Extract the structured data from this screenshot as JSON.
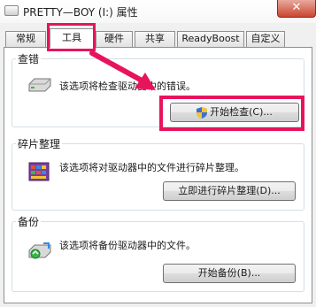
{
  "window": {
    "title": "PRETTY—BOY (I:) 属性",
    "close_glyph": "✕"
  },
  "tabs": [
    {
      "label": "常规"
    },
    {
      "label": "工具",
      "active": true
    },
    {
      "label": "硬件"
    },
    {
      "label": "共享"
    },
    {
      "label": "ReadyBoost"
    },
    {
      "label": "自定义"
    }
  ],
  "error_check": {
    "title": "查错",
    "description": "该选项将检查驱动器中的错误。",
    "button_label": "开始检查(C)...",
    "icon": "drive-icon"
  },
  "defrag": {
    "title": "碎片整理",
    "description": "该选项将对驱动器中的文件进行碎片整理。",
    "button_label": "立即进行碎片整理(D)...",
    "icon": "defrag-icon"
  },
  "backup": {
    "title": "备份",
    "description": "该选项将备份驱动器中的文件。",
    "button_label": "开始备份(B)...",
    "icon": "backup-icon"
  },
  "colors": {
    "highlight": "#e8135d",
    "close_button": "#c9462f"
  }
}
